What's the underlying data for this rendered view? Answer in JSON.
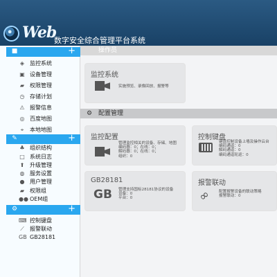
{
  "header": {
    "brand": "Web",
    "title": "数字安全综合管理平台系统"
  },
  "sidebar": {
    "groups": [
      {
        "icon": "video-camera-icon",
        "items": [
          {
            "icon": "eye-icon",
            "label": "监控系统"
          },
          {
            "icon": "video-camera-icon",
            "label": "设备管理"
          },
          {
            "icon": "lock-icon",
            "label": "权限管理"
          },
          {
            "icon": "clock-icon",
            "label": "存储计划"
          },
          {
            "icon": "warning-icon",
            "label": "报警信息"
          },
          {
            "icon": "map-pin-icon",
            "label": "百度地图"
          },
          {
            "icon": "location-icon",
            "label": "本地地图"
          }
        ]
      },
      {
        "icon": "wrench-icon",
        "items": [
          {
            "icon": "org-tree-icon",
            "label": "组织结构"
          },
          {
            "icon": "file-icon",
            "label": "系统日志"
          },
          {
            "icon": "upgrade-icon",
            "label": "升级管理"
          },
          {
            "icon": "globe-icon",
            "label": "服务设置"
          },
          {
            "icon": "user-icon",
            "label": "用户管理"
          },
          {
            "icon": "lock-icon",
            "label": "权限组"
          },
          {
            "icon": "users-icon",
            "label": "OEM组"
          }
        ]
      },
      {
        "icon": "gears-icon",
        "items": [
          {
            "icon": "keyboard-icon",
            "label": "控制键盘"
          },
          {
            "icon": "link-icon",
            "label": "报警联动"
          },
          {
            "icon": "gb-icon",
            "label": "GB28181"
          }
        ]
      }
    ]
  },
  "main": {
    "section1": "操作员",
    "section2": "配置管理",
    "cards": {
      "monitor": {
        "title": "监控系统",
        "text": "实施预览、录像回放、报警等"
      },
      "config": {
        "title": "监控配置",
        "text": [
          "管理监控相关的设备、存储、地图",
          "编码器：0；在线：0；",
          "解码器：0；在线：0；",
          "组织：0"
        ]
      },
      "keyboard": {
        "title": "控制键盘",
        "text": [
          "键盘控制设备上墙及操作云台",
          "编码通道：0",
          "解码通道：0",
          "编码通道轮巡：0"
        ]
      },
      "gb": {
        "title": "GB28181",
        "text": [
          "管理支持国标28181协议的设备",
          "设备：0",
          "平台：0"
        ]
      },
      "alarm": {
        "title": "报警联动",
        "text": [
          "配置报警设备的联动策略",
          "报警联动：0"
        ]
      }
    }
  }
}
